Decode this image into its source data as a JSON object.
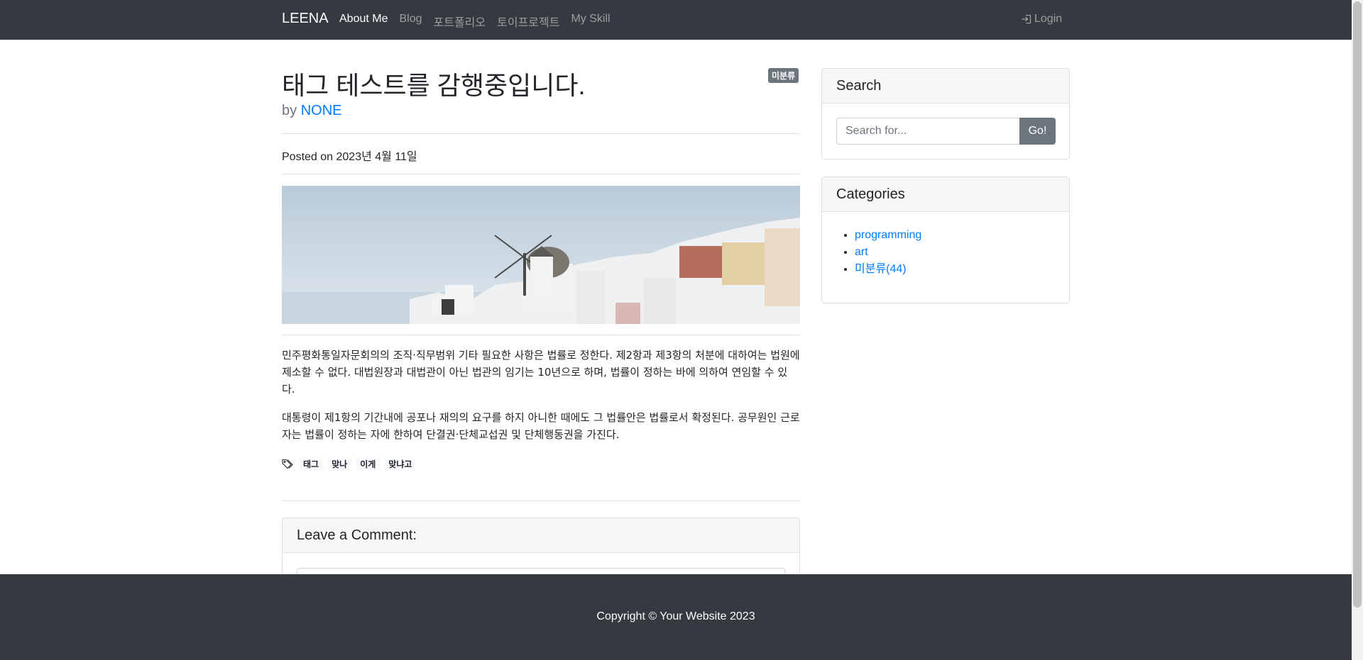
{
  "navbar": {
    "brand": "LEENA",
    "links": [
      {
        "label": "About Me"
      },
      {
        "label": "Blog"
      },
      {
        "label": "포트폴리오"
      },
      {
        "label": "토이프로젝트"
      },
      {
        "label": "My Skill"
      }
    ],
    "login_label": "Login"
  },
  "post": {
    "title": "태그 테스트를 감행중입니다.",
    "category_badge": "미분류",
    "by_prefix": "by",
    "author": "NONE",
    "posted_on": "Posted on 2023년 4월 11일",
    "paragraphs": [
      "민주평화통일자문회의의 조직·직무범위 기타 필요한 사항은 법률로 정한다. 제2항과 제3항의 처분에 대하여는 법원에 제소할 수 없다. 대법원장과 대법관이 아닌 법관의 임기는 10년으로 하며, 법률이 정하는 바에 의하여 연임할 수 있다.",
      "대통령이 제1항의 기간내에 공포나 재의의 요구를 하지 아니한 때에도 그 법률안은 법률로서 확정된다. 공무원인 근로자는 법률이 정하는 자에 한하여 단결권·단체교섭권 및 단체행동권을 가진다."
    ],
    "tags": [
      "태그",
      "맞나",
      "이게",
      "맞냐고"
    ]
  },
  "comment": {
    "header": "Leave a Comment:"
  },
  "sidebar": {
    "search": {
      "header": "Search",
      "placeholder": "Search for...",
      "button": "Go!"
    },
    "categories": {
      "header": "Categories",
      "items": [
        "programming",
        "art",
        "미분류(44)"
      ]
    }
  },
  "footer": {
    "copyright": "Copyright © Your Website 2023"
  },
  "colors": {
    "navbar_bg": "#343a40",
    "link": "#007bff",
    "badge": "#6c757d"
  }
}
